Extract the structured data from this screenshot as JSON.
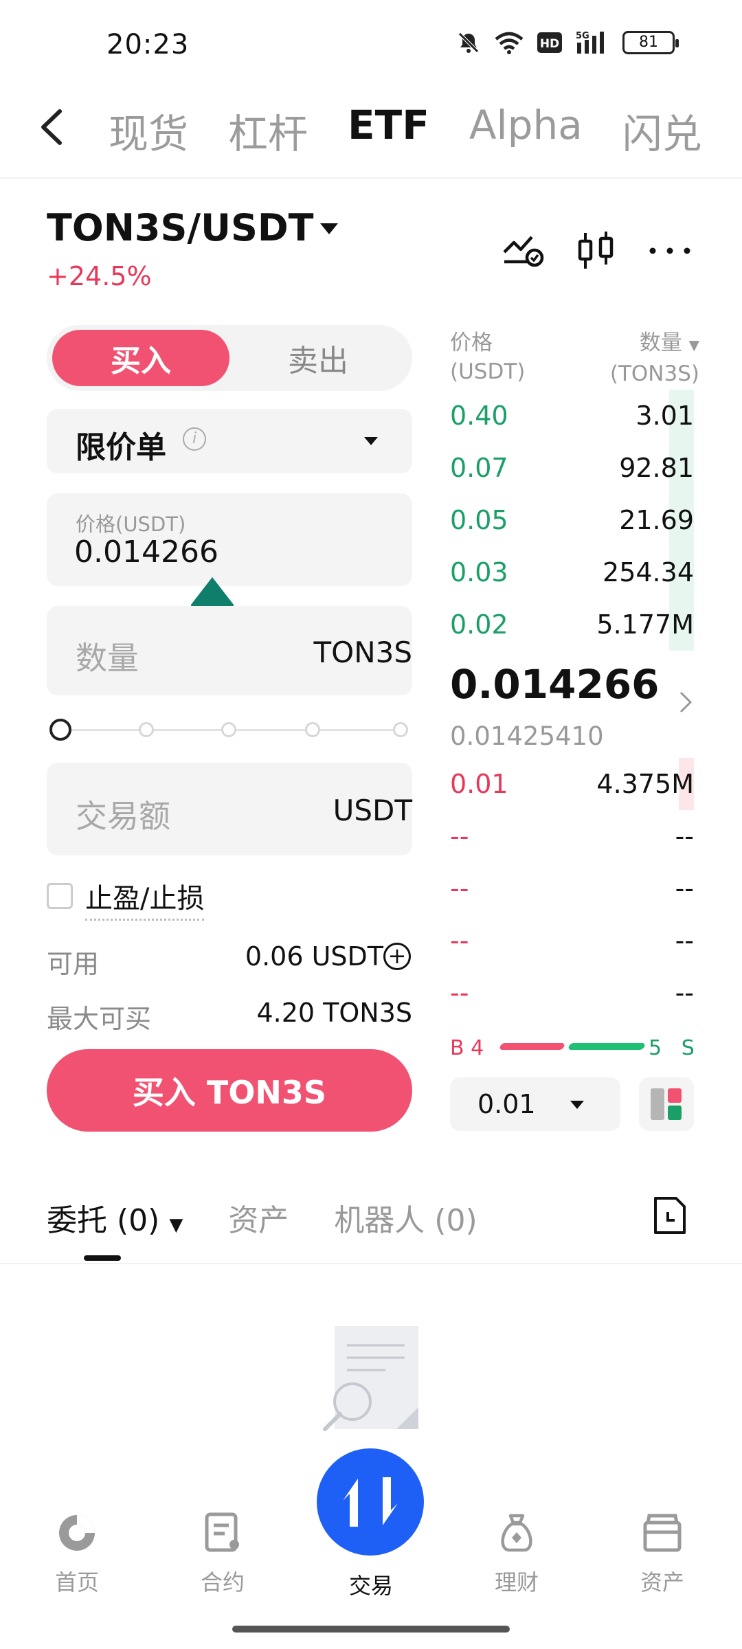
{
  "status_bar": {
    "time": "20:23",
    "battery": "81",
    "network": "5G"
  },
  "nav": {
    "tabs": [
      "现货",
      "杠杆",
      "ETF",
      "Alpha",
      "闪兑"
    ],
    "active_tab": "ETF"
  },
  "pair": {
    "symbol": "TON3S/USDT",
    "change": "+24.5%"
  },
  "order_form": {
    "buy_label": "买入",
    "sell_label": "卖出",
    "order_type": "限价单",
    "price_label": "价格(USDT)",
    "price_value": "0.014266",
    "quantity_placeholder": "数量",
    "quantity_unit": "TON3S",
    "amount_placeholder": "交易额",
    "amount_unit": "USDT",
    "tp_sl_label": "止盈/止损",
    "available_label": "可用",
    "available_value": "0.06 USDT",
    "max_buy_label": "最大可买",
    "max_buy_value": "4.20 TON3S",
    "submit_label": "买入 TON3S",
    "slider_percent": 0
  },
  "order_book": {
    "price_header": "价格",
    "price_header_unit": "(USDT)",
    "qty_header": "数量",
    "qty_header_unit": "(TON3S)",
    "asks": [
      {
        "price": "0.40",
        "qty": "3.01"
      },
      {
        "price": "0.07",
        "qty": "92.81"
      },
      {
        "price": "0.05",
        "qty": "21.69"
      },
      {
        "price": "0.03",
        "qty": "254.34"
      },
      {
        "price": "0.02",
        "qty": "5.177M"
      }
    ],
    "last_price": "0.014266",
    "mark_price": "0.01425410",
    "bids": [
      {
        "price": "0.01",
        "qty": "4.375M"
      },
      {
        "price": "--",
        "qty": "--"
      },
      {
        "price": "--",
        "qty": "--"
      },
      {
        "price": "--",
        "qty": "--"
      },
      {
        "price": "--",
        "qty": "--"
      }
    ],
    "buy_label": "B 4",
    "sell_count": "5",
    "sell_letter": "S",
    "depth": "0.01"
  },
  "bottom_tabs": {
    "orders": "委托 (0)",
    "assets": "资产",
    "bots": "机器人 (0)"
  },
  "bottom_nav": {
    "home": "首页",
    "futures": "合约",
    "trade": "交易",
    "earn": "理财",
    "assets": "资产"
  },
  "colors": {
    "buy_red": "#f15271",
    "green": "#1aa067",
    "trade_blue": "#1e5ff5"
  }
}
